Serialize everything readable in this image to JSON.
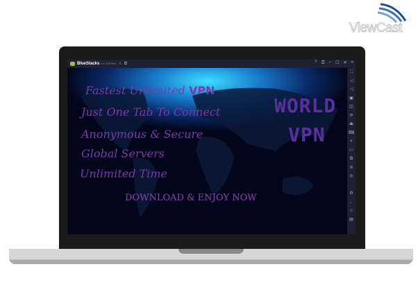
{
  "watermark": {
    "brand": "ViewCast"
  },
  "emulator": {
    "app_name": "BlueStacks",
    "version": "5.0.7228 Beta",
    "title_icons": [
      "home-icon",
      "multi-instance-icon"
    ],
    "window_controls": [
      "help-icon",
      "menu-icon",
      "minimize-icon",
      "maximize-icon",
      "close-icon",
      "collapse-icon"
    ],
    "sidebar_icons": [
      "fullscreen-icon",
      "volume-up-icon",
      "volume-down-icon",
      "media-icon",
      "screenshot-icon",
      "rotate-icon",
      "install-apk-icon",
      "keyboard-icon",
      "location-icon",
      "folder-icon",
      "copy-icon",
      "settings-layers-icon",
      "eco-icon",
      "gear-icon",
      "back-icon",
      "home-icon",
      "recents-icon"
    ]
  },
  "promo": {
    "lines": [
      "Fastest Unlimited",
      "Just One Tab To Connect",
      "Anonymous & Secure",
      "Global Servers",
      "Unlimited Time"
    ],
    "vpn_word": "VPN",
    "badge_top": "WORLD",
    "badge_bottom": "VPN",
    "cta": "DOWNLOAD & ENJOY NOW"
  }
}
